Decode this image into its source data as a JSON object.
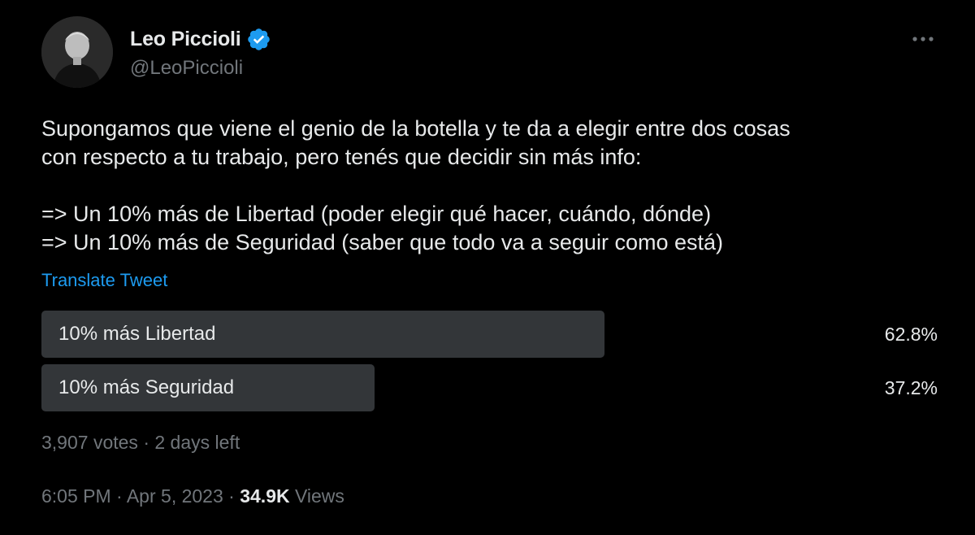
{
  "author": {
    "display_name": "Leo Piccioli",
    "handle": "@LeoPiccioli",
    "verified": true,
    "verified_color": "#1d9bf0"
  },
  "tweet": {
    "paragraphs": [
      [
        "Supongamos que viene el genio de la botella y te da a elegir entre dos cosas",
        "con respecto a tu trabajo, pero tenés que decidir sin más info:"
      ],
      [
        "=> Un 10% más de Libertad (poder elegir qué hacer, cuándo, dónde)",
        "=> Un 10% más de Seguridad (saber que todo va a seguir como está)"
      ]
    ],
    "translate_label": "Translate Tweet"
  },
  "poll": {
    "options": [
      {
        "label": "10% más Libertad",
        "percent_text": "62.8%",
        "percent": 62.8,
        "winner": true
      },
      {
        "label": "10% más Seguridad",
        "percent_text": "37.2%",
        "percent": 37.2,
        "winner": false
      }
    ],
    "votes": "3,907 votes",
    "separator": "·",
    "time_left": "2 days left"
  },
  "meta": {
    "time": "6:05 PM",
    "separator": "·",
    "date": "Apr 5, 2023",
    "views_count": "34.9K",
    "views_label": "Views"
  },
  "icons": {
    "more": "more-horizontal-icon",
    "verified": "verified-badge-icon"
  },
  "colors": {
    "background": "#000000",
    "text": "#e7e9ea",
    "secondary": "#71767b",
    "link": "#1d9bf0",
    "poll_bar": "#333639"
  }
}
